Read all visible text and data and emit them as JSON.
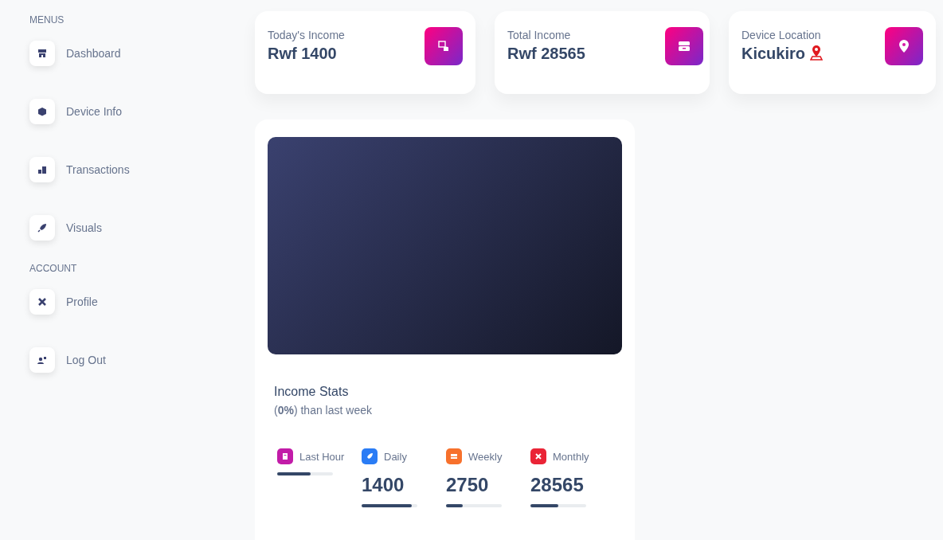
{
  "sidebar": {
    "sections": [
      {
        "heading": "MENUS",
        "items": [
          {
            "label": "Dashboard"
          },
          {
            "label": "Device Info"
          },
          {
            "label": "Transactions"
          },
          {
            "label": "Visuals"
          }
        ]
      },
      {
        "heading": "ACCOUNT",
        "items": [
          {
            "label": "Profile"
          },
          {
            "label": "Log Out"
          }
        ]
      }
    ]
  },
  "cards": [
    {
      "title": "Today's Income",
      "value": "Rwf 1400"
    },
    {
      "title": "Total Income",
      "value": "Rwf 28565"
    },
    {
      "title": "Device Location",
      "value": "Kicukiro",
      "kind": "location"
    }
  ],
  "income_stats": {
    "title": "Income Stats",
    "subtitle": "(**0%**) than last week",
    "items": [
      {
        "label": "Last Hour",
        "color": "#c21ca8",
        "level": 0.6
      },
      {
        "label": "Daily",
        "value": "1400",
        "color": "#2a7cf5",
        "level": 0.9
      },
      {
        "label": "Weekly",
        "value": "2750",
        "color": "#f7712c",
        "level": 0.3
      },
      {
        "label": "Monthly",
        "value": "28565",
        "color": "#ea2436",
        "level": 0.5
      }
    ]
  }
}
